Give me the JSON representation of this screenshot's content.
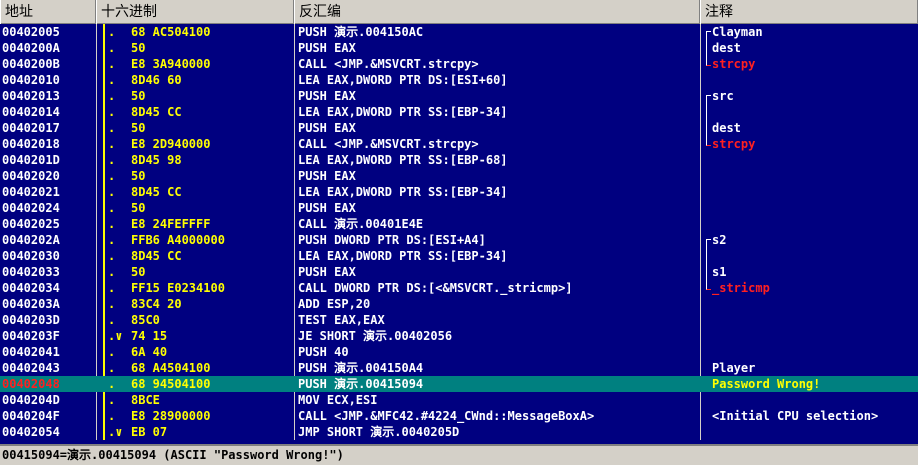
{
  "headers": {
    "address": "地址",
    "hex": "十六进制",
    "disasm": "反汇编",
    "comment": "注释"
  },
  "rows": [
    {
      "addr": "00402005",
      "mark": ".",
      "hex": "68 AC504100",
      "dis": "PUSH 演示.004150AC",
      "com": "Clayman"
    },
    {
      "addr": "0040200A",
      "mark": ".",
      "hex": "50",
      "dis": "PUSH EAX",
      "com": "dest"
    },
    {
      "addr": "0040200B",
      "mark": ".",
      "hex": "E8 3A940000",
      "dis": "CALL <JMP.&MSVCRT.strcpy>",
      "com": "strcpy"
    },
    {
      "addr": "00402010",
      "mark": ".",
      "hex": "8D46 60",
      "dis": "LEA EAX,DWORD PTR DS:[ESI+60]",
      "com": ""
    },
    {
      "addr": "00402013",
      "mark": ".",
      "hex": "50",
      "dis": "PUSH EAX",
      "com": "src"
    },
    {
      "addr": "00402014",
      "mark": ".",
      "hex": "8D45 CC",
      "dis": "LEA EAX,DWORD PTR SS:[EBP-34]",
      "com": ""
    },
    {
      "addr": "00402017",
      "mark": ".",
      "hex": "50",
      "dis": "PUSH EAX",
      "com": "dest"
    },
    {
      "addr": "00402018",
      "mark": ".",
      "hex": "E8 2D940000",
      "dis": "CALL <JMP.&MSVCRT.strcpy>",
      "com": "strcpy"
    },
    {
      "addr": "0040201D",
      "mark": ".",
      "hex": "8D45 98",
      "dis": "LEA EAX,DWORD PTR SS:[EBP-68]",
      "com": ""
    },
    {
      "addr": "00402020",
      "mark": ".",
      "hex": "50",
      "dis": "PUSH EAX",
      "com": ""
    },
    {
      "addr": "00402021",
      "mark": ".",
      "hex": "8D45 CC",
      "dis": "LEA EAX,DWORD PTR SS:[EBP-34]",
      "com": ""
    },
    {
      "addr": "00402024",
      "mark": ".",
      "hex": "50",
      "dis": "PUSH EAX",
      "com": ""
    },
    {
      "addr": "00402025",
      "mark": ".",
      "hex": "E8 24FEFFFF",
      "dis": "CALL 演示.00401E4E",
      "com": ""
    },
    {
      "addr": "0040202A",
      "mark": ".",
      "hex": "FFB6 A4000000",
      "dis": "PUSH DWORD PTR DS:[ESI+A4]",
      "com": "s2"
    },
    {
      "addr": "00402030",
      "mark": ".",
      "hex": "8D45 CC",
      "dis": "LEA EAX,DWORD PTR SS:[EBP-34]",
      "com": ""
    },
    {
      "addr": "00402033",
      "mark": ".",
      "hex": "50",
      "dis": "PUSH EAX",
      "com": "s1"
    },
    {
      "addr": "00402034",
      "mark": ".",
      "hex": "FF15 E0234100",
      "dis": "CALL DWORD PTR DS:[<&MSVCRT._stricmp>]",
      "com": "_stricmp"
    },
    {
      "addr": "0040203A",
      "mark": ".",
      "hex": "83C4 20",
      "dis": "ADD ESP,20",
      "com": ""
    },
    {
      "addr": "0040203D",
      "mark": ".",
      "hex": "85C0",
      "dis": "TEST EAX,EAX",
      "com": ""
    },
    {
      "addr": "0040203F",
      "mark": ".∨",
      "hex": "74 15",
      "dis": "JE SHORT 演示.00402056",
      "com": ""
    },
    {
      "addr": "00402041",
      "mark": ".",
      "hex": "6A 40",
      "dis": "PUSH 40",
      "com": ""
    },
    {
      "addr": "00402043",
      "mark": ".",
      "hex": "68 A4504100",
      "dis": "PUSH 演示.004150A4",
      "com": "Player"
    },
    {
      "addr": "00402048",
      "mark": ".",
      "hex": "68 94504100",
      "dis": "PUSH 演示.00415094",
      "com": "Password Wrong!"
    },
    {
      "addr": "0040204D",
      "mark": ".",
      "hex": "8BCE",
      "dis": "MOV ECX,ESI",
      "com": ""
    },
    {
      "addr": "0040204F",
      "mark": ".",
      "hex": "E8 28900000",
      "dis": "CALL <JMP.&MFC42.#4224_CWnd::MessageBoxA>",
      "com": "<Initial CPU selection>"
    },
    {
      "addr": "00402054",
      "mark": ".∨",
      "hex": "EB 07",
      "dis": "JMP SHORT 演示.0040205D",
      "com": ""
    }
  ],
  "selected_row": 22,
  "red_comment_rows": [
    2,
    7,
    16
  ],
  "status": {
    "text": "00415094=演示.00415094 (ASCII \"Password Wrong!\")"
  },
  "colors": {
    "background": "#000080",
    "selection": "#008080",
    "hex_text": "#ffff00",
    "api_comment": "#ff2020",
    "header_bg": "#d4d0c8"
  }
}
